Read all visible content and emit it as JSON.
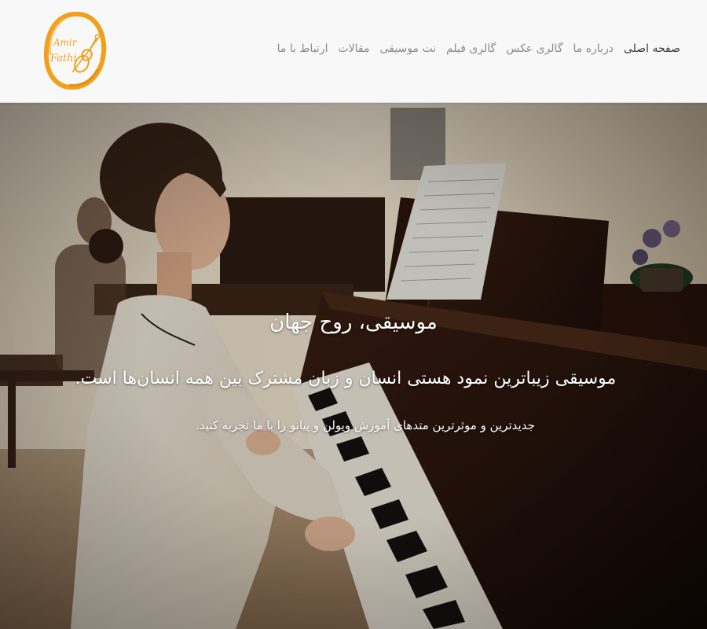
{
  "brand": {
    "logo_line1": "Amir",
    "logo_line2": "Fathi",
    "accent": "#f0a01a"
  },
  "nav": {
    "items": [
      {
        "label": "صفحه اصلی",
        "active": true
      },
      {
        "label": "درباره ما",
        "active": false
      },
      {
        "label": "گالری عکس",
        "active": false
      },
      {
        "label": "گالری فیلم",
        "active": false
      },
      {
        "label": "نت موسیقی",
        "active": false
      },
      {
        "label": "مقالات",
        "active": false
      },
      {
        "label": "ارتباط با ما",
        "active": false
      }
    ]
  },
  "hero": {
    "title": "موسیقی، روح جهان",
    "subtitle": "موسیقی زیباترین نمود هستی انسان و زبان مشترک بین همه انسان‌ها است.",
    "tagline": "جدیدترین و موثرترین متدهای آموزش ویولن و پیانو را با ما تجربه کنید."
  }
}
